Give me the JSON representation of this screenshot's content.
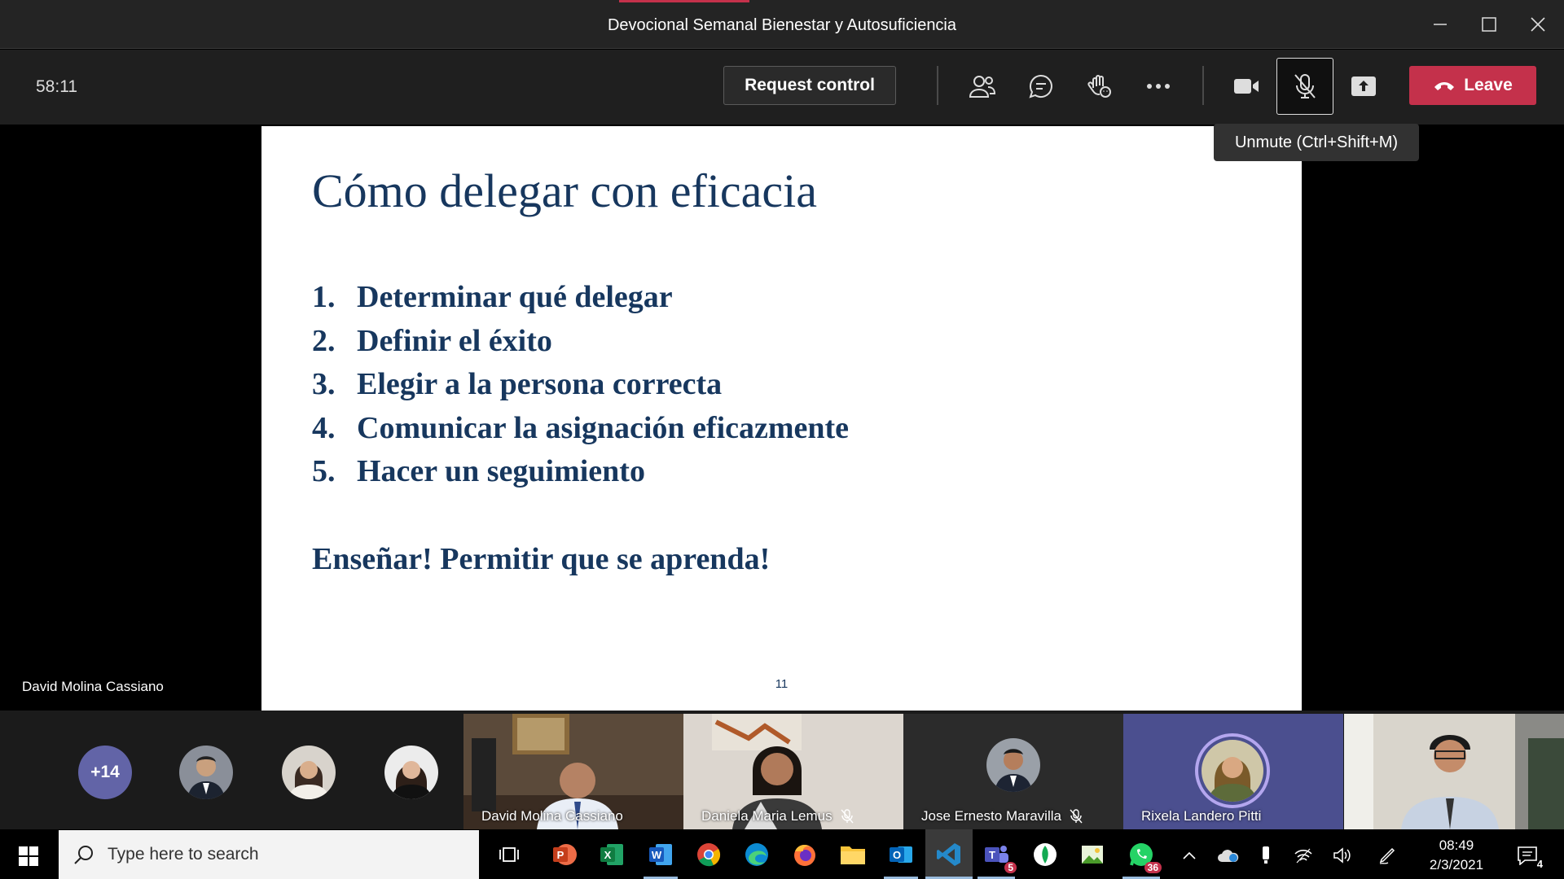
{
  "window": {
    "title": "Devocional Semanal Bienestar y Autosuficiencia"
  },
  "meeting": {
    "timer": "58:11",
    "request_control_label": "Request control",
    "leave_label": "Leave",
    "tooltip": "Unmute (Ctrl+Shift+M)",
    "presenter_name": "David Molina Cassiano"
  },
  "slide": {
    "title": "Cómo delegar con eficacia",
    "items": [
      {
        "num": "1.",
        "text": "Determinar qué delegar"
      },
      {
        "num": "2.",
        "text": "Definir el éxito"
      },
      {
        "num": "3.",
        "text": "Elegir a la persona correcta"
      },
      {
        "num": "4.",
        "text": "Comunicar la asignación eficazmente"
      },
      {
        "num": "5.",
        "text": "Hacer un seguimiento"
      }
    ],
    "closing": "Enseñar! Permitir que se aprenda!",
    "page_number": "11"
  },
  "participants": {
    "overflow_count": "+14",
    "tiles": [
      {
        "name": "David Molina Cassiano",
        "muted": false
      },
      {
        "name": "Daniela Maria Lemus",
        "muted": true
      },
      {
        "name": "Jose Ernesto Maravilla",
        "muted": true
      },
      {
        "name": "Rixela Landero Pitti",
        "muted": false
      },
      {
        "name": "",
        "muted": false
      }
    ]
  },
  "taskbar": {
    "search_placeholder": "Type here to search",
    "teams_badge": "5",
    "whatsapp_badge": "36",
    "time": "08:49",
    "date": "2/3/2021",
    "notifications_count": "4"
  },
  "colors": {
    "slide_text": "#17375e",
    "leave_button": "#c4314b",
    "avatar_overflow": "#6264a7"
  }
}
